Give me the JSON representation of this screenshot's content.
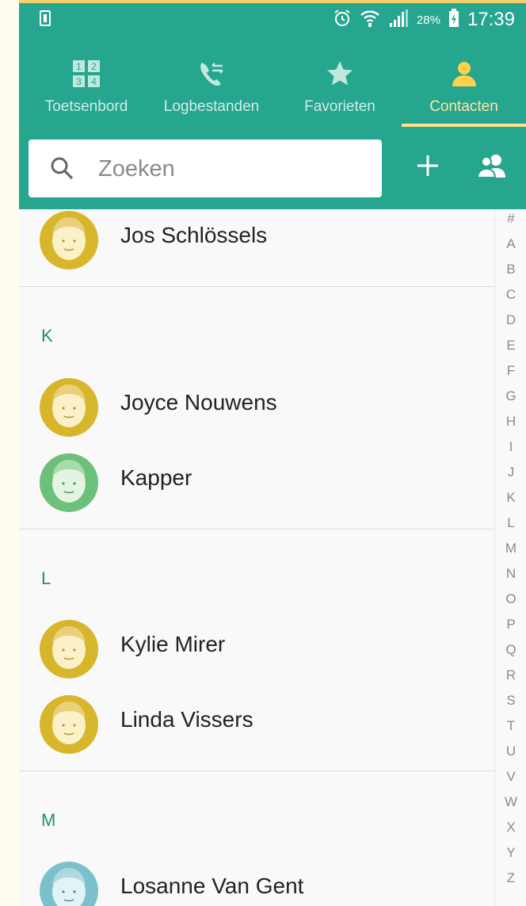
{
  "status_bar": {
    "battery_percent": "28%",
    "time": "17:39"
  },
  "tabs": [
    {
      "label": "Toetsenbord",
      "icon": "keypad-icon",
      "active": false
    },
    {
      "label": "Logbestanden",
      "icon": "call-log-icon",
      "active": false
    },
    {
      "label": "Favorieten",
      "icon": "star-icon",
      "active": false
    },
    {
      "label": "Contacten",
      "icon": "contact-icon",
      "active": true
    }
  ],
  "search": {
    "placeholder": "Zoeken"
  },
  "actions": {
    "add": "plus-icon",
    "groups": "groups-icon"
  },
  "sections": [
    {
      "letter": "",
      "contacts": [
        {
          "name": "Jos Schlössels",
          "avatar_color": "#d8b62b"
        }
      ]
    },
    {
      "letter": "K",
      "contacts": [
        {
          "name": "Joyce Nouwens",
          "avatar_color": "#d8b62b"
        },
        {
          "name": "Kapper",
          "avatar_color": "#6cc07a"
        }
      ]
    },
    {
      "letter": "L",
      "contacts": [
        {
          "name": "Kylie Mirer",
          "avatar_color": "#d8b62b"
        },
        {
          "name": "Linda Vissers",
          "avatar_color": "#d8b62b"
        }
      ]
    },
    {
      "letter": "M",
      "contacts": [
        {
          "name": "Losanne Van Gent",
          "avatar_color": "#7cc0cc"
        }
      ]
    }
  ],
  "index_letters": [
    "#",
    "A",
    "B",
    "C",
    "D",
    "E",
    "F",
    "G",
    "H",
    "I",
    "J",
    "K",
    "L",
    "M",
    "N",
    "O",
    "P",
    "Q",
    "R",
    "S",
    "T",
    "U",
    "V",
    "W",
    "X",
    "Y",
    "Z"
  ],
  "colors": {
    "header": "#26a58f",
    "active_tab": "#ffe6a3",
    "section_letter": "#1f8f7a"
  }
}
